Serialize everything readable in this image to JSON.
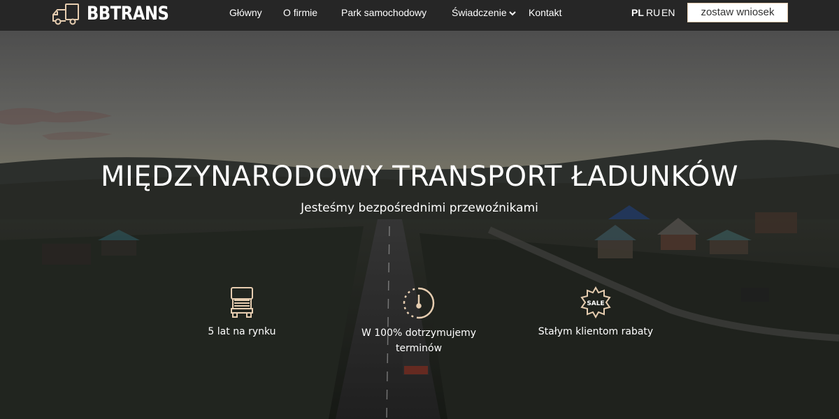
{
  "brand": {
    "name": "BBTRANS"
  },
  "nav": {
    "items": [
      {
        "label": "Główny"
      },
      {
        "label": "O firmie"
      },
      {
        "label": "Park samochodowy"
      },
      {
        "label": "Świadczenie",
        "has_dropdown": true
      },
      {
        "label": "Kontakt"
      }
    ]
  },
  "languages": {
    "items": [
      "PL",
      "RU",
      "EN"
    ],
    "active": "PL"
  },
  "cta": {
    "label": "zostaw wniosek"
  },
  "hero": {
    "title": "MIĘDZYNARODOWY TRANSPORT ŁADUNKÓW",
    "subtitle": "Jesteśmy bezpośrednimi przewoźnikami"
  },
  "features": [
    {
      "icon": "truck-icon",
      "label": "5 lat na rynku"
    },
    {
      "icon": "clock-icon",
      "label": "W 100% dotrzymujemy terminów"
    },
    {
      "icon": "sale-badge-icon",
      "label": "Stałym klientom rabaty"
    }
  ],
  "colors": {
    "header_bg": "#262626",
    "accent": "#e6cdb0",
    "text": "#ffffff"
  }
}
